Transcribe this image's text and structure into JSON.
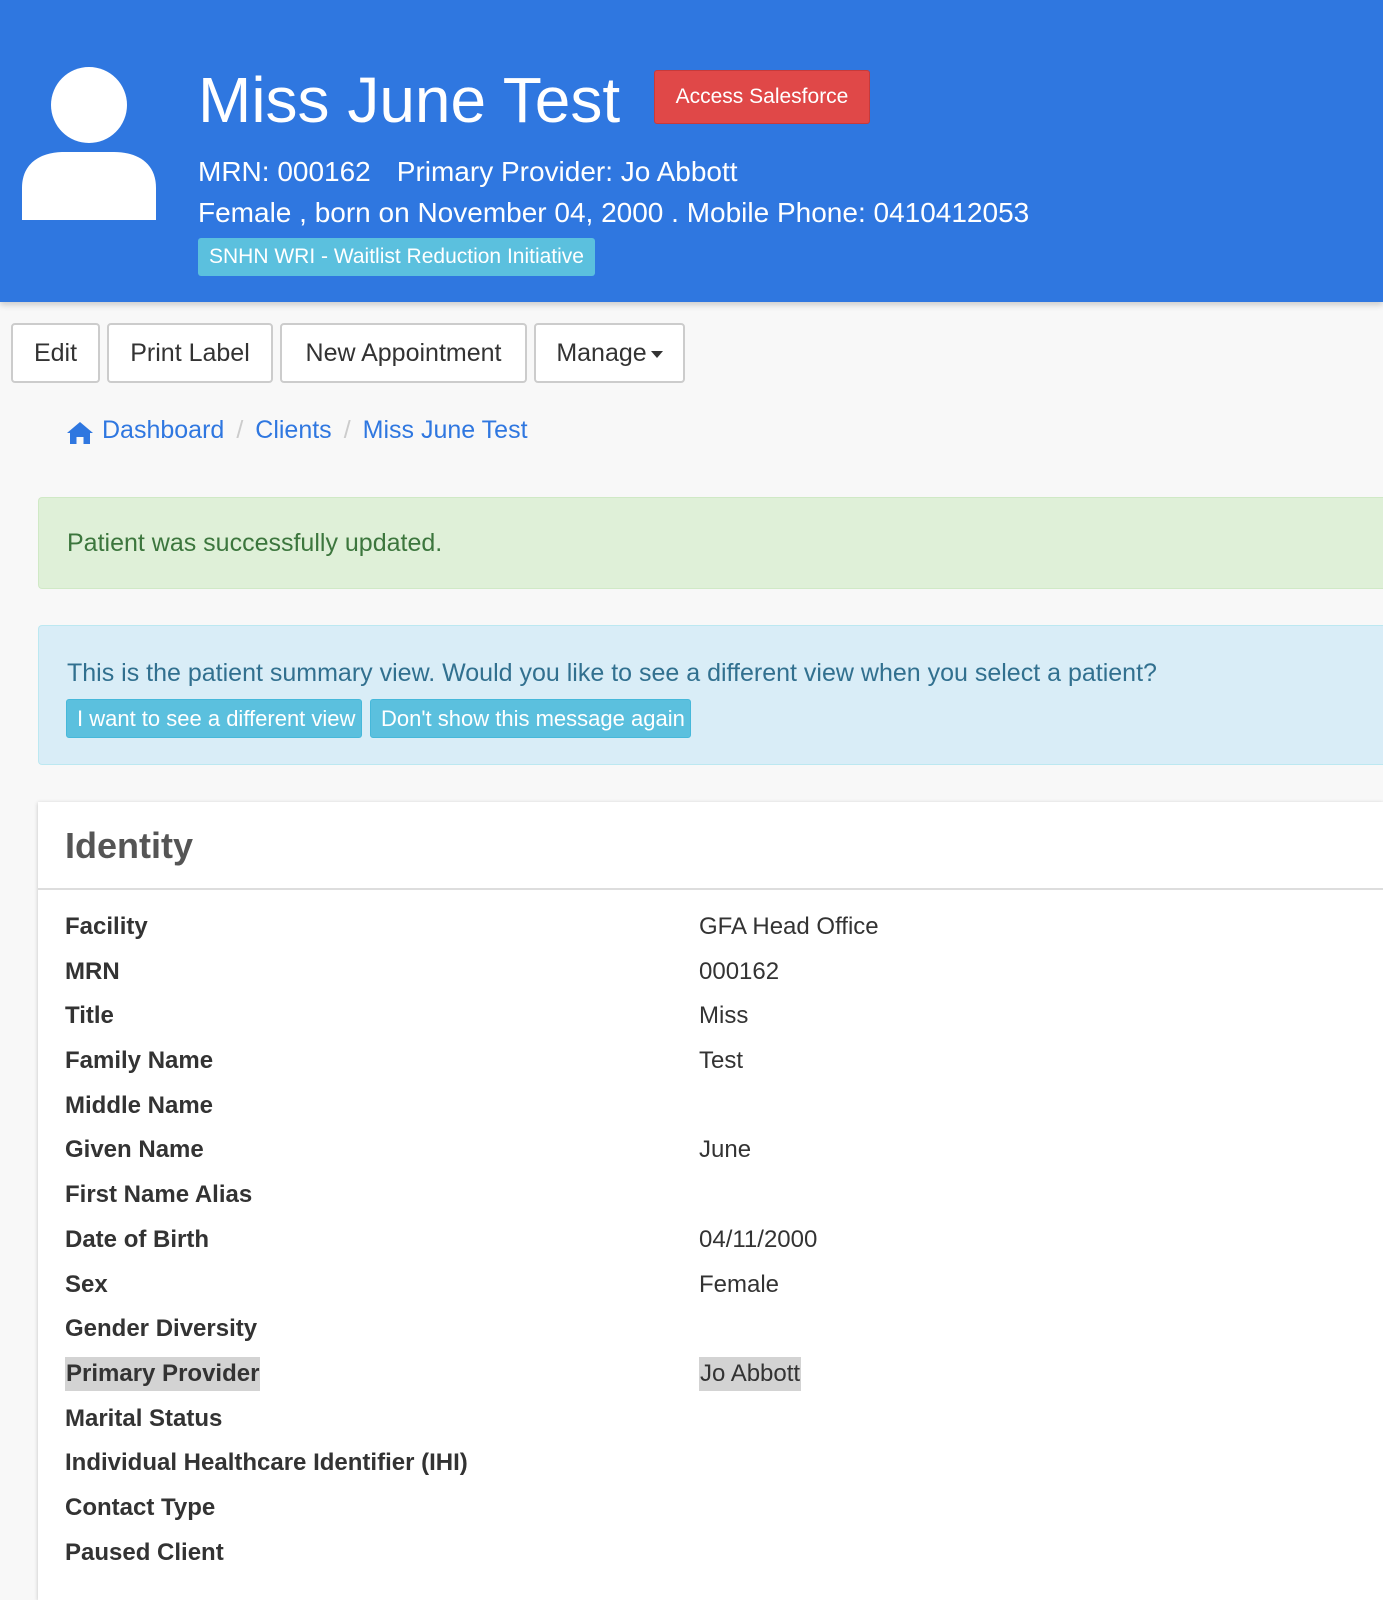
{
  "header": {
    "patient_name": "Miss June Test",
    "access_salesforce_label": "Access Salesforce",
    "mrn_text": "MRN: 000162",
    "primary_provider_text": "Primary Provider: Jo Abbott",
    "demographics_text": "Female , born on November 04, 2000 . Mobile Phone: 0410412053",
    "program_badge": "SNHN WRI - Waitlist Reduction Initiative",
    "avatar_icon": "user-silhouette-icon",
    "background_color": "#2f77e0",
    "salesforce_button_color": "#e04848",
    "badge_color": "#5bc0de"
  },
  "toolbar": {
    "edit_label": "Edit",
    "print_label": "Print Label",
    "new_appointment_label": "New Appointment",
    "manage_label": "Manage"
  },
  "breadcrumb": {
    "home_icon": "home-icon",
    "items": [
      "Dashboard",
      "Clients",
      "Miss June Test"
    ],
    "separator": "/"
  },
  "alerts": {
    "success_message": "Patient was successfully updated.",
    "info_message": "This is the patient summary view. Would you like to see a different view when you select a patient?",
    "different_view_button": "I want to see a different view",
    "dont_show_button": "Don't show this message again"
  },
  "identity": {
    "title": "Identity",
    "fields": [
      {
        "label": "Facility",
        "value": "GFA Head Office"
      },
      {
        "label": "MRN",
        "value": "000162"
      },
      {
        "label": "Title",
        "value": "Miss"
      },
      {
        "label": "Family Name",
        "value": "Test"
      },
      {
        "label": "Middle Name",
        "value": ""
      },
      {
        "label": "Given Name",
        "value": "June"
      },
      {
        "label": "First Name Alias",
        "value": ""
      },
      {
        "label": "Date of Birth",
        "value": "04/11/2000"
      },
      {
        "label": "Sex",
        "value": "Female"
      },
      {
        "label": "Gender Diversity",
        "value": ""
      },
      {
        "label": "Primary Provider",
        "value": "Jo Abbott"
      },
      {
        "label": "Marital Status",
        "value": ""
      },
      {
        "label": "Individual Healthcare Identifier (IHI)",
        "value": ""
      },
      {
        "label": "Contact Type",
        "value": ""
      },
      {
        "label": "Paused Client",
        "value": ""
      }
    ]
  }
}
